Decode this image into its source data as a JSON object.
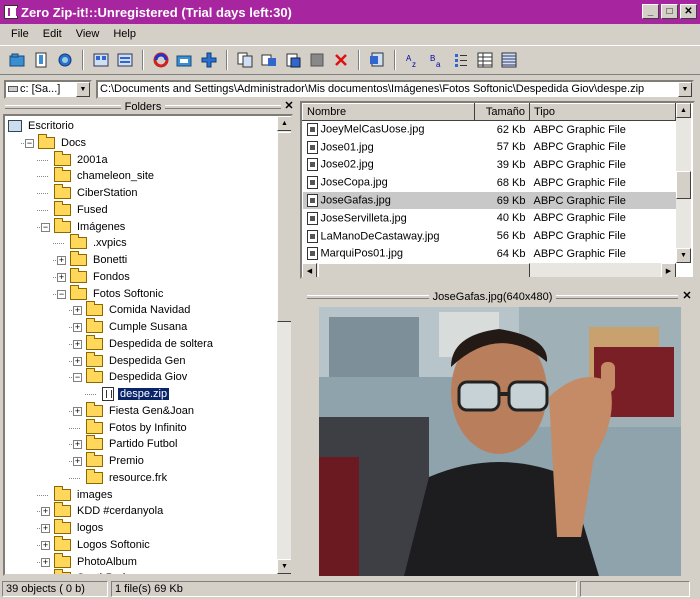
{
  "window": {
    "title": "Zero Zip-it!::Unregistered (Trial days left:30)",
    "controls": [
      "_",
      "□",
      "✕"
    ]
  },
  "menu": [
    "File",
    "Edit",
    "View",
    "Help"
  ],
  "toolbar": {
    "icons": [
      "open-icon",
      "new-archive-icon",
      "refresh-icon",
      "view-large-icon",
      "view-small-icon",
      "extract-icon",
      "add-folder-icon",
      "add-icon",
      "copy-icon",
      "move-icon",
      "paste-icon",
      "stop-icon",
      "delete-icon",
      "properties-icon",
      "sort-az-icon",
      "sort-za-icon",
      "list-icon",
      "details-icon",
      "grid-icon"
    ]
  },
  "address": {
    "drive": "c: [Sa...]",
    "path": "C:\\Documents and Settings\\Administrador\\Mis documentos\\Imágenes\\Fotos Softonic\\Despedida Giov\\despe.zip"
  },
  "folders_panel": {
    "title": "Folders",
    "close": "✕",
    "nodes": [
      {
        "label": "Escritorio",
        "depth": 0,
        "expander": "",
        "kind": "pc"
      },
      {
        "label": "Docs",
        "depth": 1,
        "expander": "−",
        "kind": "folder"
      },
      {
        "label": "2001a",
        "depth": 2,
        "expander": "",
        "kind": "folder"
      },
      {
        "label": "chameleon_site",
        "depth": 2,
        "expander": "",
        "kind": "folder"
      },
      {
        "label": "CiberStation",
        "depth": 2,
        "expander": "",
        "kind": "folder"
      },
      {
        "label": "Fused",
        "depth": 2,
        "expander": "",
        "kind": "folder"
      },
      {
        "label": "Imágenes",
        "depth": 2,
        "expander": "−",
        "kind": "folder"
      },
      {
        "label": ".xvpics",
        "depth": 3,
        "expander": "",
        "kind": "folder"
      },
      {
        "label": "Bonetti",
        "depth": 3,
        "expander": "+",
        "kind": "folder"
      },
      {
        "label": "Fondos",
        "depth": 3,
        "expander": "+",
        "kind": "folder"
      },
      {
        "label": "Fotos Softonic",
        "depth": 3,
        "expander": "−",
        "kind": "folder"
      },
      {
        "label": "Comida Navidad",
        "depth": 4,
        "expander": "+",
        "kind": "folder"
      },
      {
        "label": "Cumple Susana",
        "depth": 4,
        "expander": "+",
        "kind": "folder"
      },
      {
        "label": "Despedida de soltera",
        "depth": 4,
        "expander": "+",
        "kind": "folder"
      },
      {
        "label": "Despedida Gen",
        "depth": 4,
        "expander": "+",
        "kind": "folder"
      },
      {
        "label": "Despedida Giov",
        "depth": 4,
        "expander": "−",
        "kind": "folder"
      },
      {
        "label": "despe.zip",
        "depth": 5,
        "expander": "",
        "kind": "zip",
        "selected": true
      },
      {
        "label": "Fiesta Gen&Joan",
        "depth": 4,
        "expander": "+",
        "kind": "folder"
      },
      {
        "label": "Fotos by Infinito",
        "depth": 4,
        "expander": "",
        "kind": "folder"
      },
      {
        "label": "Partido Futbol",
        "depth": 4,
        "expander": "+",
        "kind": "folder"
      },
      {
        "label": "Premio",
        "depth": 4,
        "expander": "+",
        "kind": "folder"
      },
      {
        "label": "resource.frk",
        "depth": 4,
        "expander": "",
        "kind": "folder"
      },
      {
        "label": "images",
        "depth": 2,
        "expander": "",
        "kind": "folder"
      },
      {
        "label": "KDD #cerdanyola",
        "depth": 2,
        "expander": "+",
        "kind": "folder"
      },
      {
        "label": "logos",
        "depth": 2,
        "expander": "+",
        "kind": "folder"
      },
      {
        "label": "Logos Softonic",
        "depth": 2,
        "expander": "+",
        "kind": "folder"
      },
      {
        "label": "PhotoAlbum",
        "depth": 2,
        "expander": "+",
        "kind": "folder"
      },
      {
        "label": "SouthPark",
        "depth": 2,
        "expander": "+",
        "kind": "folder"
      }
    ]
  },
  "file_list": {
    "columns": [
      "Nombre",
      "Tamaño",
      "Tipo"
    ],
    "rows": [
      {
        "name": "JoeyMelCasUose.jpg",
        "size": "62 Kb",
        "type": "ABPC Graphic File"
      },
      {
        "name": "Jose01.jpg",
        "size": "57 Kb",
        "type": "ABPC Graphic File"
      },
      {
        "name": "Jose02.jpg",
        "size": "39 Kb",
        "type": "ABPC Graphic File"
      },
      {
        "name": "JoseCopa.jpg",
        "size": "68 Kb",
        "type": "ABPC Graphic File"
      },
      {
        "name": "JoseGafas.jpg",
        "size": "69 Kb",
        "type": "ABPC Graphic File",
        "selected": true
      },
      {
        "name": "JoseServilleta.jpg",
        "size": "40 Kb",
        "type": "ABPC Graphic File"
      },
      {
        "name": "LaManoDeCastaway.jpg",
        "size": "56 Kb",
        "type": "ABPC Graphic File"
      },
      {
        "name": "MarquiPos01.jpg",
        "size": "64 Kb",
        "type": "ABPC Graphic File"
      }
    ]
  },
  "preview_panel": {
    "title": "JoseGafas.jpg(640x480)",
    "close": "✕"
  },
  "status": {
    "objects": "39 objects ( 0 b)",
    "selection": "1 file(s) 69 Kb"
  }
}
